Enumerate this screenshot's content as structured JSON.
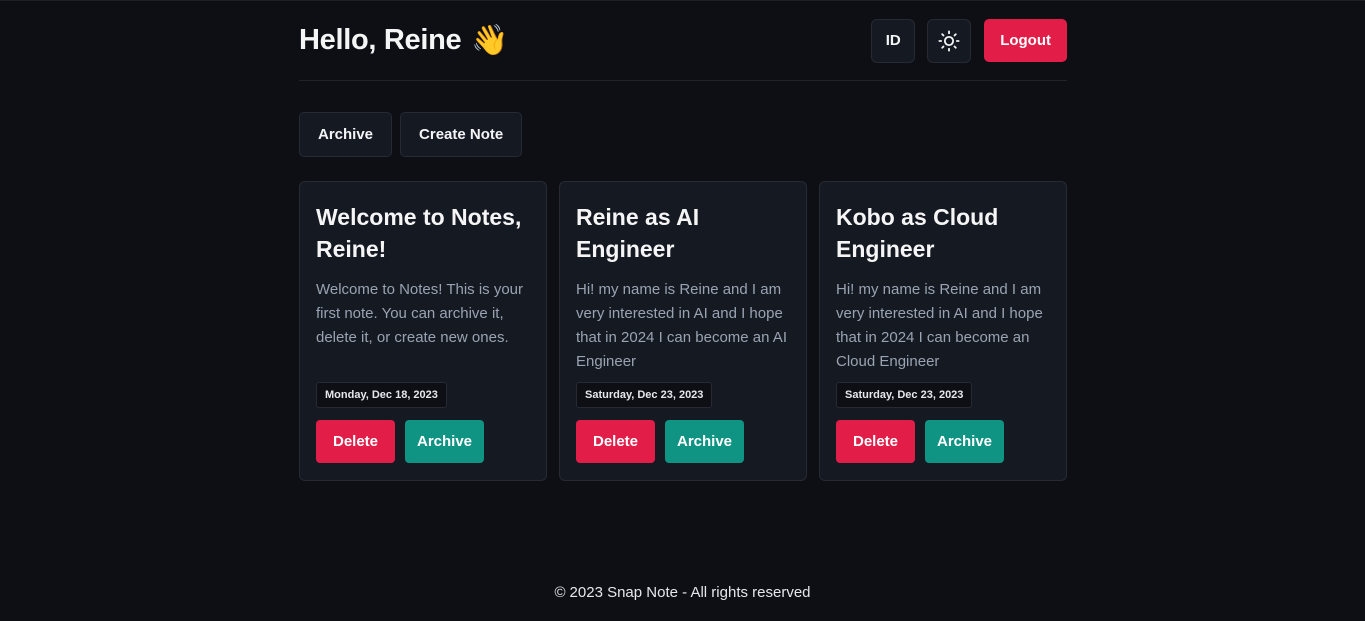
{
  "header": {
    "greeting": "Hello, Reine",
    "wave_emoji": "👋",
    "lang_button": "ID",
    "theme_icon": "sun-icon",
    "logout_label": "Logout"
  },
  "toolbar": {
    "archive_label": "Archive",
    "create_label": "Create Note"
  },
  "notes": [
    {
      "title": "Welcome to Notes, Reine!",
      "body": "Welcome to Notes! This is your first note. You can archive it, delete it, or create new ones.",
      "date": "Monday, Dec 18, 2023",
      "delete_label": "Delete",
      "archive_label": "Archive"
    },
    {
      "title": "Reine as AI Engineer",
      "body": "Hi! my name is Reine and I am very interested in AI and I hope that in 2024 I can become an AI Engineer",
      "date": "Saturday, Dec 23, 2023",
      "delete_label": "Delete",
      "archive_label": "Archive"
    },
    {
      "title": "Kobo as Cloud Engineer",
      "body": "Hi! my name is Reine and I am very interested in AI and I hope that in 2024 I can become an Cloud Engineer",
      "date": "Saturday, Dec 23, 2023",
      "delete_label": "Delete",
      "archive_label": "Archive"
    }
  ],
  "footer": {
    "copyright_symbol": "©",
    "text": "2023 Snap Note - All rights reserved"
  },
  "colors": {
    "background": "#0d0f15",
    "card": "#151922",
    "danger": "#e11d48",
    "archive": "#0f9484"
  }
}
